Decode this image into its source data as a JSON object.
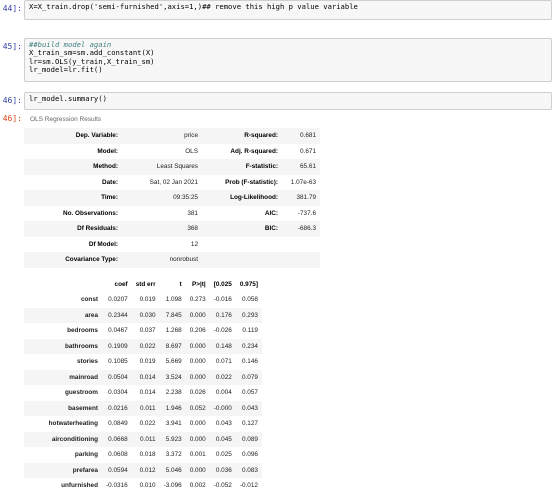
{
  "cells": {
    "c44": {
      "prompt": "44]:",
      "code": "X=X_train.drop('semi-furnished',axis=1,)## remove this high p value variable"
    },
    "c45": {
      "prompt": "45]:",
      "lines": [
        "##build model again",
        "X_train_sm=sm.add_constant(X)",
        "lr=sm.OLS(y_train,X_train_sm)",
        "lr_model=lr.fit()"
      ]
    },
    "c46": {
      "prompt": "46]:",
      "code": "lr_model.summary()",
      "out_prompt": "46]:"
    }
  },
  "summary": {
    "caption": "OLS Regression Results",
    "rows": [
      [
        "Dep. Variable:",
        "price",
        "R-squared:",
        "0.681"
      ],
      [
        "Model:",
        "OLS",
        "Adj. R-squared:",
        "0.671"
      ],
      [
        "Method:",
        "Least Squares",
        "F-statistic:",
        "65.61"
      ],
      [
        "Date:",
        "Sat, 02 Jan 2021",
        "Prob (F-statistic):",
        "1.07e-63"
      ],
      [
        "Time:",
        "09:35:25",
        "Log-Likelihood:",
        "381.79"
      ],
      [
        "No. Observations:",
        "381",
        "AIC:",
        "-737.6"
      ],
      [
        "Df Residuals:",
        "368",
        "BIC:",
        "-686.3"
      ],
      [
        "Df Model:",
        "12",
        "",
        ""
      ],
      [
        "Covariance Type:",
        "nonrobust",
        "",
        ""
      ]
    ]
  },
  "coef_table": {
    "headers": [
      "",
      "coef",
      "std err",
      "t",
      "P>|t|",
      "[0.025",
      "0.975]"
    ],
    "rows": [
      [
        "const",
        "0.0207",
        "0.019",
        "1.098",
        "0.273",
        "-0.016",
        "0.058"
      ],
      [
        "area",
        "0.2344",
        "0.030",
        "7.845",
        "0.000",
        "0.176",
        "0.293"
      ],
      [
        "bedrooms",
        "0.0467",
        "0.037",
        "1.268",
        "0.206",
        "-0.026",
        "0.119"
      ],
      [
        "bathrooms",
        "0.1909",
        "0.022",
        "8.697",
        "0.000",
        "0.148",
        "0.234"
      ],
      [
        "stories",
        "0.1085",
        "0.019",
        "5.669",
        "0.000",
        "0.071",
        "0.146"
      ],
      [
        "mainroad",
        "0.0504",
        "0.014",
        "3.524",
        "0.000",
        "0.022",
        "0.079"
      ],
      [
        "guestroom",
        "0.0304",
        "0.014",
        "2.238",
        "0.026",
        "0.004",
        "0.057"
      ],
      [
        "basement",
        "0.0216",
        "0.011",
        "1.946",
        "0.052",
        "-0.000",
        "0.043"
      ],
      [
        "hotwaterheating",
        "0.0849",
        "0.022",
        "3.941",
        "0.000",
        "0.043",
        "0.127"
      ],
      [
        "airconditioning",
        "0.0668",
        "0.011",
        "5.923",
        "0.000",
        "0.045",
        "0.089"
      ],
      [
        "parking",
        "0.0608",
        "0.018",
        "3.372",
        "0.001",
        "0.025",
        "0.096"
      ],
      [
        "prefarea",
        "0.0594",
        "0.012",
        "5.046",
        "0.000",
        "0.036",
        "0.083"
      ],
      [
        "unfurnished",
        "-0.0316",
        "0.010",
        "-3.096",
        "0.002",
        "-0.052",
        "-0.012"
      ]
    ]
  }
}
